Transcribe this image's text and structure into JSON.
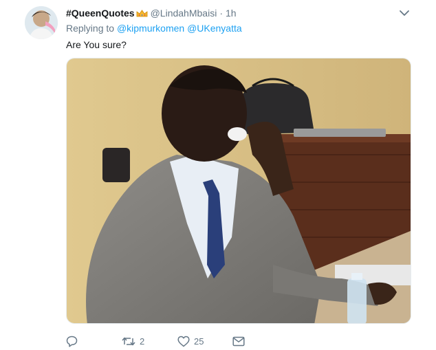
{
  "tweet": {
    "display_name": "#QueenQuotes",
    "handle": "@LindahMbaisi",
    "separator": "·",
    "time": "1h",
    "replying_prefix": "Replying to",
    "reply_mentions": [
      "@kipmurkomen",
      "@UKenyatta"
    ],
    "text": "Are You sure?",
    "avatar_icon": "user-avatar",
    "badge_icon": "crown-emoji"
  },
  "actions": {
    "reply": {
      "icon": "reply-icon",
      "count": ""
    },
    "retweet": {
      "icon": "retweet-icon",
      "count": "2"
    },
    "like": {
      "icon": "heart-icon",
      "count": "25"
    },
    "message": {
      "icon": "mail-icon",
      "count": ""
    }
  },
  "colors": {
    "link": "#1da1f2",
    "secondary_text": "#657786",
    "primary_text": "#14171a"
  }
}
